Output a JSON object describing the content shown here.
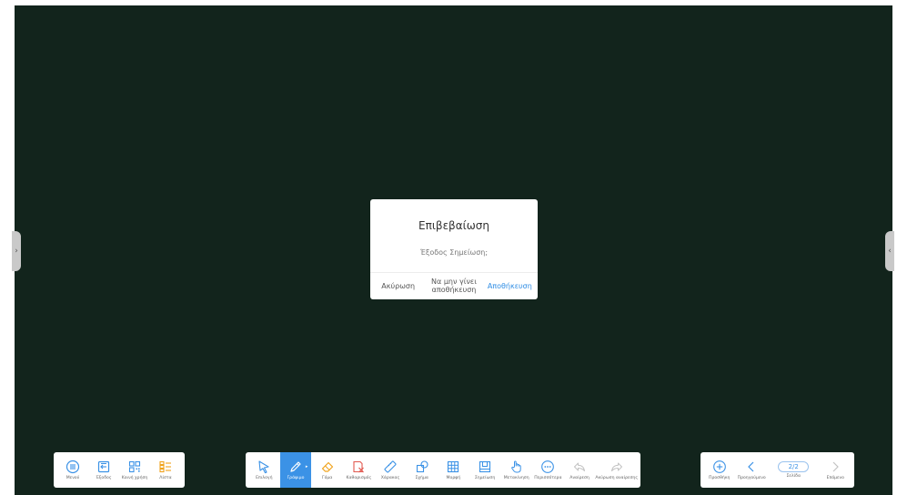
{
  "dialog": {
    "title": "Επιβεβαίωση",
    "message": "Έξοδος Σημείωση;",
    "cancel": "Ακύρωση",
    "dont_save": "Να μην γίνει αποθήκευση",
    "save": "Αποθήκευση"
  },
  "left_toolbar": [
    {
      "label": "Μενού",
      "icon": "menu-icon"
    },
    {
      "label": "Έξοδος",
      "icon": "exit-icon"
    },
    {
      "label": "Κοινή χρήση",
      "icon": "qr-share-icon"
    },
    {
      "label": "Λίστα",
      "icon": "list-icon"
    }
  ],
  "main_toolbar": [
    {
      "label": "Επιλογή",
      "icon": "select-cursor-icon"
    },
    {
      "label": "Γράψιμο",
      "icon": "pen-icon",
      "active": true
    },
    {
      "label": "Γόμα",
      "icon": "eraser-icon"
    },
    {
      "label": "Καθαρισμός",
      "icon": "clear-icon"
    },
    {
      "label": "Χάρακας",
      "icon": "ruler-icon"
    },
    {
      "label": "Σχήμα",
      "icon": "shape-icon"
    },
    {
      "label": "Μορφή",
      "icon": "table-icon"
    },
    {
      "label": "Σημείωση",
      "icon": "note-icon"
    },
    {
      "label": "Μετακίνηση",
      "icon": "hand-icon"
    },
    {
      "label": "Περισσότερα",
      "icon": "more-icon"
    },
    {
      "label": "Αναίρεση",
      "icon": "undo-icon"
    },
    {
      "label": "Ακύρωση αναίρεσης",
      "icon": "redo-icon"
    }
  ],
  "right_toolbar": {
    "add": "Προσθήκη",
    "prev": "Προηγούμενο",
    "page_value": "2/2",
    "page_label": "Σελίδα",
    "next": "Επόμενο"
  },
  "colors": {
    "board": "#12241c",
    "accent": "#3b92e6"
  }
}
